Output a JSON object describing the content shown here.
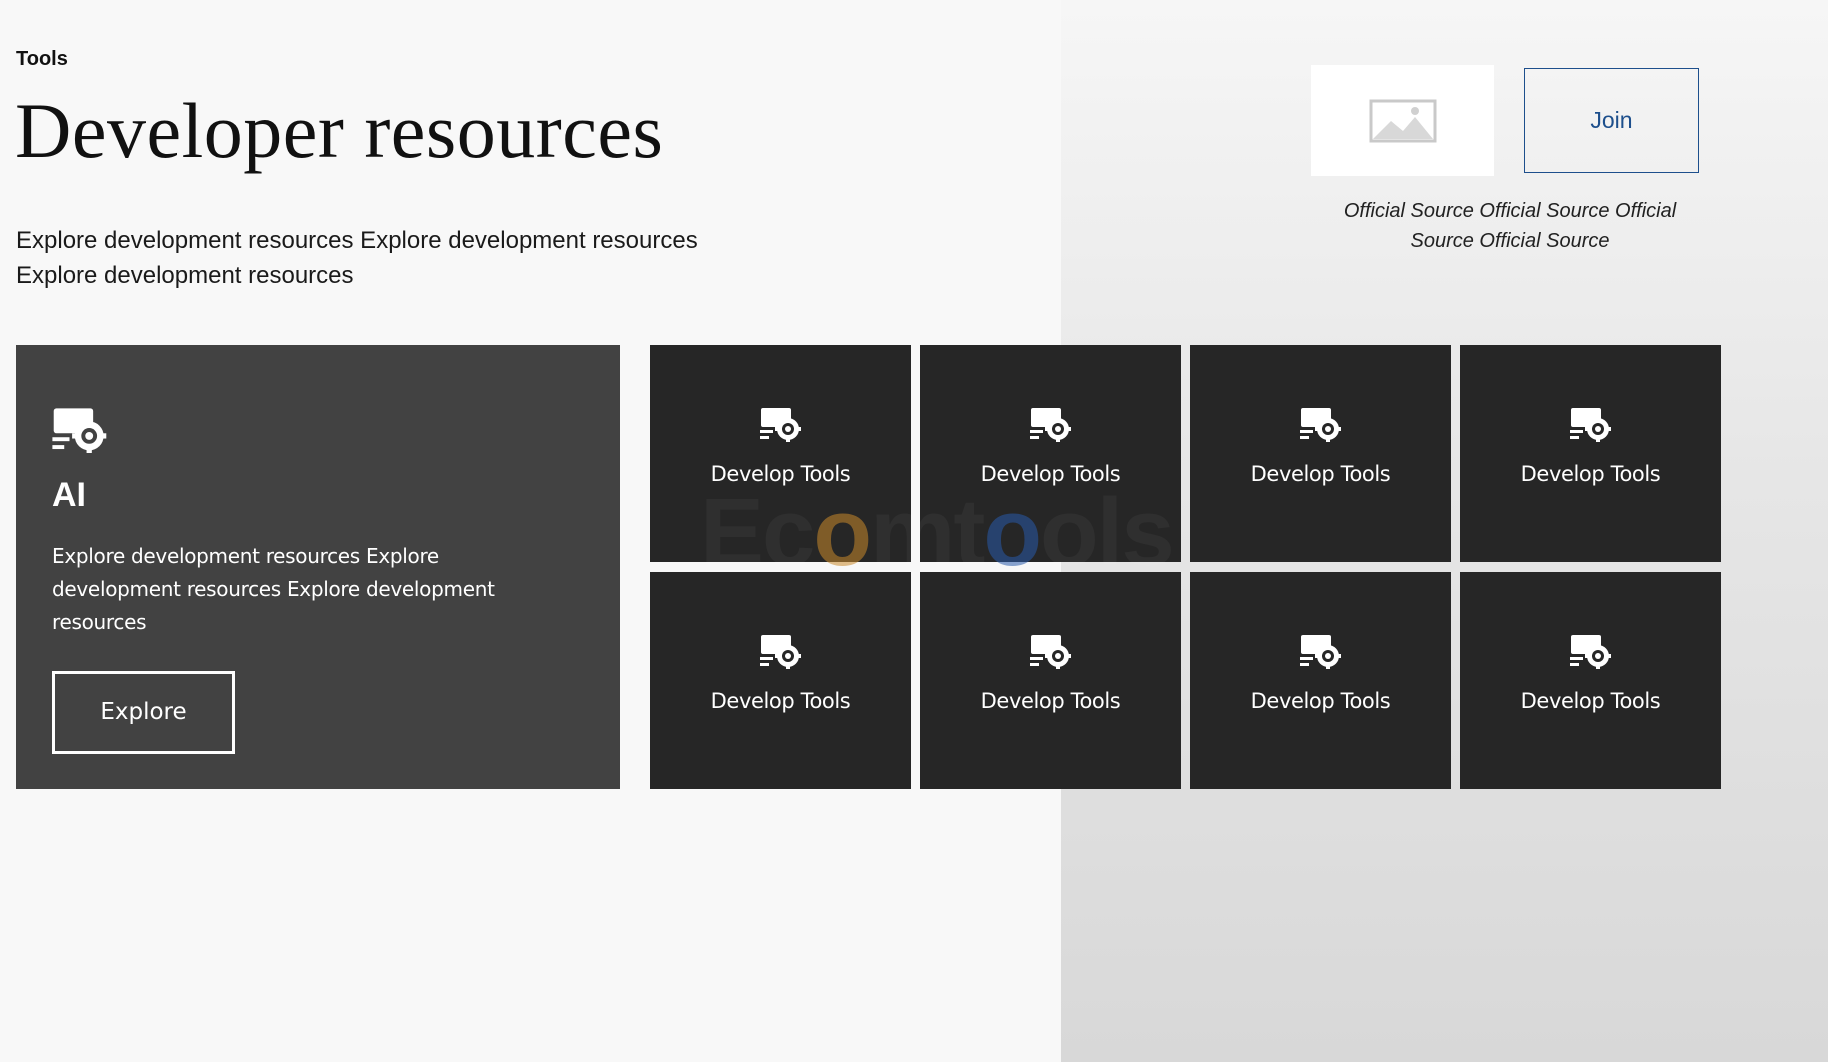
{
  "header": {
    "eyebrow": "Tools",
    "title": "Developer resources",
    "lead": "Explore development resources Explore development resources Explore development resources"
  },
  "aside": {
    "image_icon": "image-placeholder-icon",
    "join_label": "Join",
    "source_note": "Official Source Official Source Official Source Official Source"
  },
  "feature": {
    "icon": "developer-tools-icon",
    "title": "AI",
    "description": "Explore development resources Explore development resources Explore development resources",
    "button_label": "Explore"
  },
  "tiles": [
    {
      "label": "Develop Tools",
      "icon": "developer-tools-icon"
    },
    {
      "label": "Develop Tools",
      "icon": "developer-tools-icon"
    },
    {
      "label": "Develop Tools",
      "icon": "developer-tools-icon"
    },
    {
      "label": "Develop Tools",
      "icon": "developer-tools-icon"
    },
    {
      "label": "Develop Tools",
      "icon": "developer-tools-icon"
    },
    {
      "label": "Develop Tools",
      "icon": "developer-tools-icon"
    },
    {
      "label": "Develop Tools",
      "icon": "developer-tools-icon"
    },
    {
      "label": "Develop Tools",
      "icon": "developer-tools-icon"
    }
  ],
  "watermark": {
    "brand_logo": "Ecomtools"
  },
  "colors": {
    "page_background": "#f8f8f8",
    "feature_background": "#424242",
    "tile_background": "#262626",
    "accent": "#1d4f8c"
  }
}
